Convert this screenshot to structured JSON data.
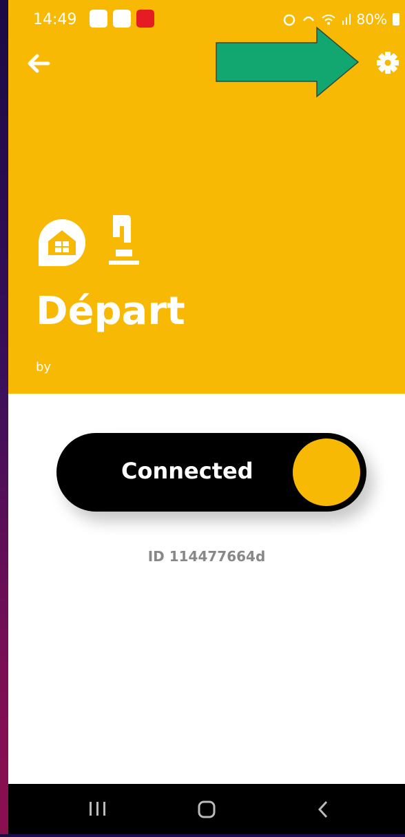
{
  "status_bar": {
    "time": "14:49",
    "battery": "80%",
    "notification_icons": [
      "app-notification-icon",
      "ifttt-icon",
      "volume-icon"
    ],
    "system_icons": [
      "alarm-icon",
      "wifi-call-icon",
      "wifi-icon",
      "signal-icon",
      "battery-icon"
    ]
  },
  "header": {
    "title": "Départ",
    "by_line": "by",
    "background_color": "#f7b903",
    "service_icons": [
      "home-icon",
      "button-press-icon"
    ]
  },
  "toolbar": {
    "back_icon": "arrow-left-icon",
    "settings_icon": "gear-icon"
  },
  "annotation": {
    "arrow_color": "#12a670",
    "points_to": "settings"
  },
  "toggle": {
    "label": "Connected",
    "state": "on",
    "knob_color": "#f7b903"
  },
  "applet": {
    "id_text": "ID 114477664d"
  },
  "nav_bar": {
    "buttons": [
      "recent-apps-icon",
      "home-icon",
      "back-icon"
    ]
  }
}
